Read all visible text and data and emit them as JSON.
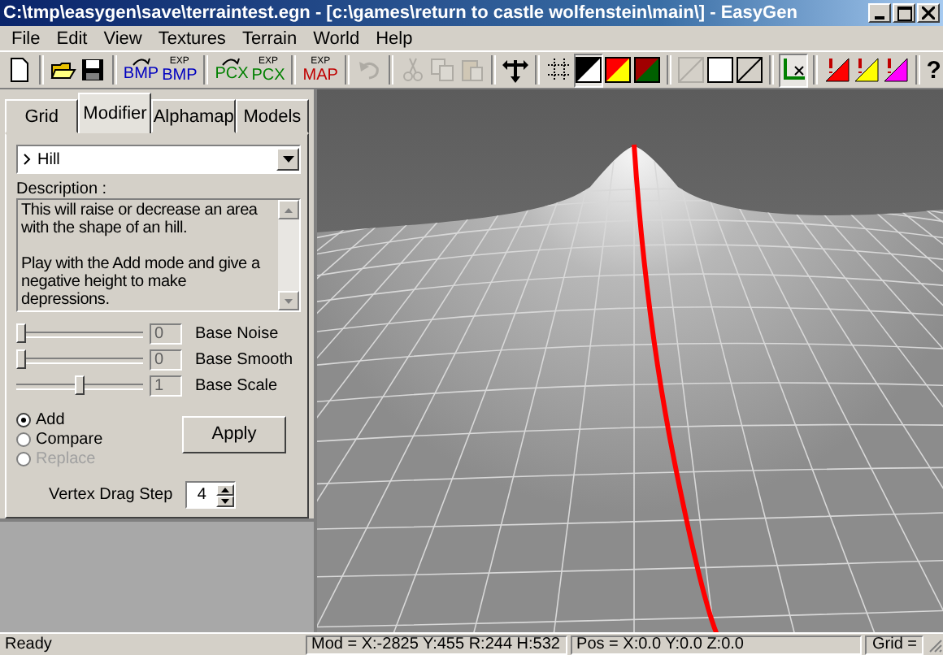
{
  "window": {
    "title": "C:\\tmp\\easygen\\save\\terraintest.egn - [c:\\games\\return to castle wolfenstein\\main\\] - EasyGen"
  },
  "menu": [
    "File",
    "Edit",
    "View",
    "Textures",
    "Terrain",
    "World",
    "Help"
  ],
  "toolbar": [
    {
      "kind": "new",
      "disabled": false,
      "pressed": false
    },
    {
      "kind": "sep"
    },
    {
      "kind": "open",
      "disabled": false,
      "pressed": false
    },
    {
      "kind": "save",
      "disabled": false,
      "pressed": false
    },
    {
      "kind": "sep"
    },
    {
      "kind": "import",
      "label": "BMP",
      "color": "#0000c0",
      "disabled": false,
      "pressed": false
    },
    {
      "kind": "export",
      "top": "EXP",
      "label": "BMP",
      "color": "#0000c0",
      "disabled": false,
      "pressed": false
    },
    {
      "kind": "sep"
    },
    {
      "kind": "import",
      "label": "PCX",
      "color": "#008000",
      "disabled": false,
      "pressed": false
    },
    {
      "kind": "export",
      "top": "EXP",
      "label": "PCX",
      "color": "#008000",
      "disabled": false,
      "pressed": false
    },
    {
      "kind": "sep"
    },
    {
      "kind": "export",
      "top": "EXP",
      "label": "MAP",
      "color": "#c00000",
      "disabled": false,
      "pressed": false
    },
    {
      "kind": "sep"
    },
    {
      "kind": "undo",
      "disabled": true,
      "pressed": false
    },
    {
      "kind": "sep"
    },
    {
      "kind": "cut",
      "disabled": true,
      "pressed": false
    },
    {
      "kind": "copy",
      "disabled": true,
      "pressed": false
    },
    {
      "kind": "paste",
      "disabled": true,
      "pressed": false
    },
    {
      "kind": "sep"
    },
    {
      "kind": "move",
      "disabled": false,
      "pressed": false
    },
    {
      "kind": "sep"
    },
    {
      "kind": "grid",
      "disabled": false,
      "pressed": false
    },
    {
      "kind": "swatch-bw",
      "disabled": false,
      "pressed": true
    },
    {
      "kind": "swatch-ry",
      "disabled": false,
      "pressed": false
    },
    {
      "kind": "swatch-rg",
      "disabled": false,
      "pressed": false
    },
    {
      "kind": "sep"
    },
    {
      "kind": "frame-diag",
      "disabled": true,
      "pressed": false
    },
    {
      "kind": "frame",
      "disabled": false,
      "pressed": false
    },
    {
      "kind": "frame-diag",
      "disabled": false,
      "pressed": false
    },
    {
      "kind": "sep"
    },
    {
      "kind": "axis",
      "disabled": false,
      "pressed": true
    },
    {
      "kind": "sep"
    },
    {
      "kind": "tri-red",
      "disabled": false,
      "pressed": false
    },
    {
      "kind": "tri-yellow",
      "disabled": false,
      "pressed": false
    },
    {
      "kind": "tri-magenta",
      "disabled": false,
      "pressed": false
    },
    {
      "kind": "sep"
    },
    {
      "kind": "help",
      "label": "?",
      "disabled": false,
      "pressed": false
    }
  ],
  "panel": {
    "tabs": [
      {
        "label": "Grid",
        "selected": false
      },
      {
        "label": "Modifier",
        "selected": true
      },
      {
        "label": "Alphamap",
        "selected": false
      },
      {
        "label": "Models",
        "selected": false
      }
    ],
    "modifier": {
      "value": "Hill"
    },
    "description_label": "Description :",
    "description": [
      "This will raise or decrease an area with the shape of an hill.",
      "Play with the Add mode and give a negative height to make depressions."
    ],
    "sliders": [
      {
        "label": "Base Noise",
        "value": "0",
        "level": 0
      },
      {
        "label": "Base Smooth",
        "value": "0",
        "level": 0
      },
      {
        "label": "Base Scale",
        "value": "1",
        "level": 0.5
      }
    ],
    "modes": [
      {
        "label": "Add",
        "selected": true,
        "disabled": false
      },
      {
        "label": "Compare",
        "selected": false,
        "disabled": false
      },
      {
        "label": "Replace",
        "selected": false,
        "disabled": true
      }
    ],
    "apply_button": "Apply",
    "vertex_drag_step": {
      "label": "Vertex Drag Step",
      "value": "4"
    }
  },
  "status_bar": [
    "Ready",
    "Mod = X:-2825 Y:455 R:244 H:532",
    "Pos = X:0.0 Y:0.0 Z:0.0",
    "Grid ="
  ]
}
